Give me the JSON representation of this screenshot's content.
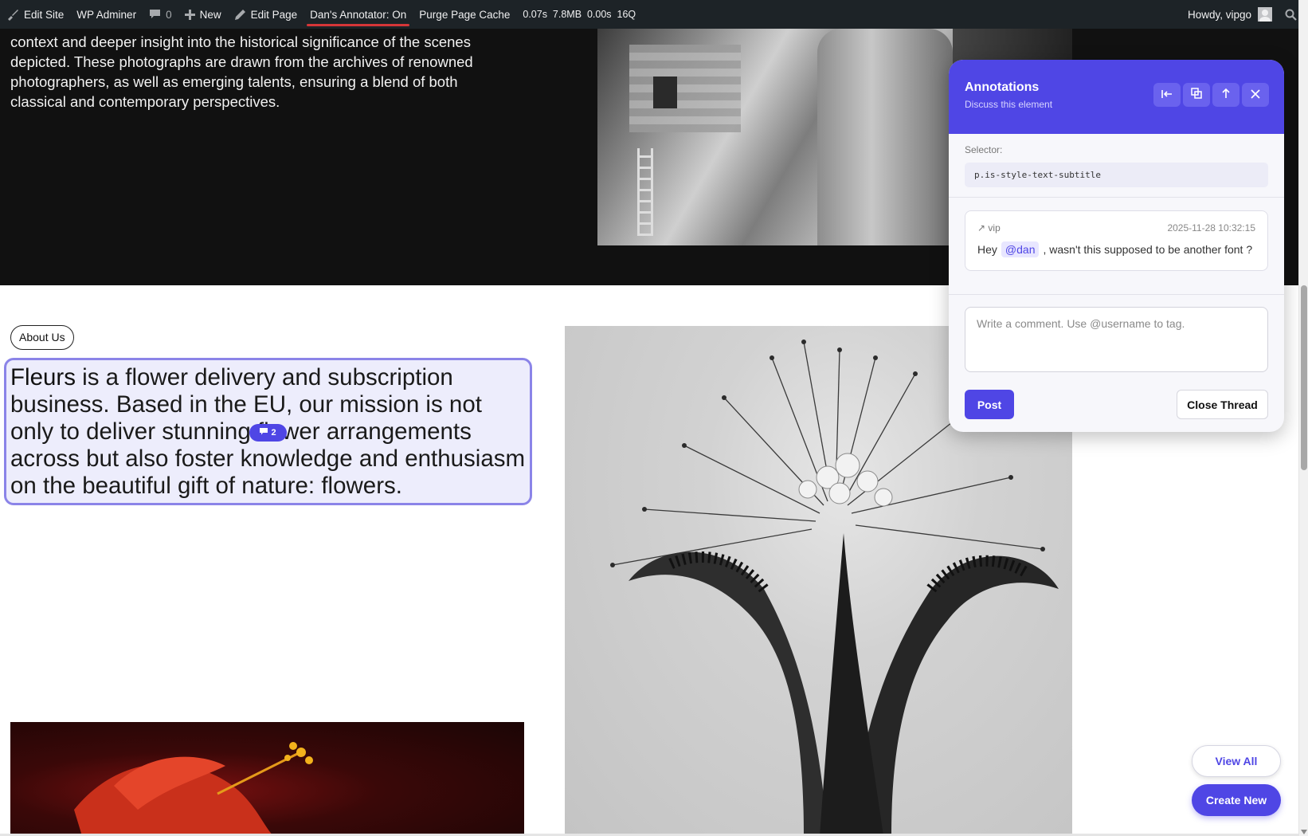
{
  "adminbar": {
    "edit_site": "Edit Site",
    "wp_adminer": "WP Adminer",
    "comments_count": "0",
    "new_label": "New",
    "edit_page": "Edit Page",
    "annotator": "Dan's Annotator: On",
    "purge_cache": "Purge Page Cache",
    "stats": "0.07s  7.8MB  0.00s  16Q",
    "howdy": "Howdy, vipgo"
  },
  "hero": {
    "text": "context and deeper insight into the historical significance of the scenes depicted. These photographs are drawn from the archives of renowned photographers, as well as emerging talents, ensuring a blend of both classical and contemporary perspectives."
  },
  "about": {
    "pill": "About Us",
    "brand": "Fleurs",
    "subtitle_rest": " is a flower delivery and subscription business. Based in the EU, our mission is not only to deliver stunning flower arrangements across but also foster knowledge and enthusiasm on the beautiful gift of nature: flowers.",
    "comment_count": "2"
  },
  "panel": {
    "title": "Annotations",
    "subtitle": "Discuss this element",
    "selector_label": "Selector:",
    "selector_value": "p.is-style-text-subtitle",
    "thread": {
      "author": "vip",
      "timestamp": "2025-11-28 10:32:15",
      "msg_before": "Hey",
      "mention": "@dan",
      "msg_after": ", wasn't this supposed to be another font ?"
    },
    "comment_placeholder": "Write a comment. Use @username to tag.",
    "post_label": "Post",
    "close_label": "Close Thread"
  },
  "floating": {
    "view_all": "View All",
    "create_new": "Create New"
  },
  "colors": {
    "accent": "#4f46e5",
    "adminbar": "#1d2327",
    "annotator_underline": "#d63638"
  }
}
